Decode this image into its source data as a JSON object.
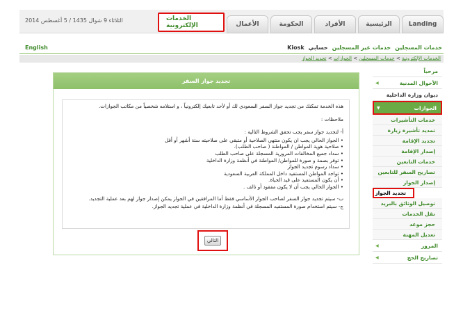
{
  "header": {
    "date": "الثلاثاء 9 شوال 1435 / 5 أغسطس 2014",
    "tabs": [
      "Landing",
      "الرئيسية",
      "الأفراد",
      "الحكومة",
      "الأعمال",
      "الخدمات الإلكترونية"
    ],
    "active_tab": "الخدمات الإلكترونية"
  },
  "lang_link": "English",
  "top_links": [
    "خدمات المسجلين",
    "خدمات غير المسجلين",
    "حسابي",
    "Kiosk"
  ],
  "breadcrumb": {
    "items": [
      "الخدمات الإلكترونية",
      "خدمات المسجلين",
      "الجوازات",
      "تجديد الجواز"
    ]
  },
  "sidebar": {
    "welcome": "مرحباً",
    "civil": "الأحوال المدنية",
    "moi": "ديوان وزارة الداخلية",
    "passports": "الجوازات",
    "sub_items": [
      "خدمات التأشيرات",
      "تمديد تأشيرة زيارة",
      "تجديد الإقامة",
      "إصدار الإقامة",
      "خدمات التابعين",
      "تصاريح السفر للتابعين",
      "إصدار الجواز",
      "تجديد الجواز",
      "توصيل الوثائق بالبريد",
      "نقل الخدمات",
      "حجز موعد",
      "تعديل المهنة"
    ],
    "traffic": "المرور",
    "hajj": "تصاريح الحج"
  },
  "panel": {
    "title": "تجديد جواز السفر",
    "intro": "هذه الخدمة تمكنك من تجديد جواز السفر السعودي لك أو لأحد تابعيك إلكترونياً ، و استلامه شخصياً من مكاتب الجوازات.",
    "notes_label": "ملاحظات :",
    "cond_title": "أ- لتجديد جواز سفر يجب تحقق الشروط التالية :",
    "conditions": [
      "الجواز الحالي يجب ان يكون منتهي الصلاحية أو متبقي على صلاحيته ستة أشهر أو أقل",
      "صلاحية هوية المواطن / المواطنة ( صاحب الطلب).",
      "سداد جميع المخالفات المرورية المسجلة على صاحب الطلب",
      "توفر بصمة و صورة للمواطن/ المواطنة في أنظمة وزارة الداخلية",
      "سداد رسوم تجديد الجواز",
      "تواجد المواطن المستفيد داخل المملكة العربية السعودية",
      "أن يكون المستفيد على قيد الحياة.",
      "الجواز الحالي يجب أن لا يكون مفقود أو تالف ."
    ],
    "note_b": "ب- سيتم تجديد جواز السفر لصاحب الجواز الأساسي فقط أما المرافقين في الجواز يمكن إصدار جواز لهم بعد عملية التجديد.",
    "note_c": "ج- سيتم استخدام صورة المستفيد المسجلة في أنظمة وزارة الداخلية في عملية تجديد الجواز.",
    "next_button": "التالي"
  }
}
